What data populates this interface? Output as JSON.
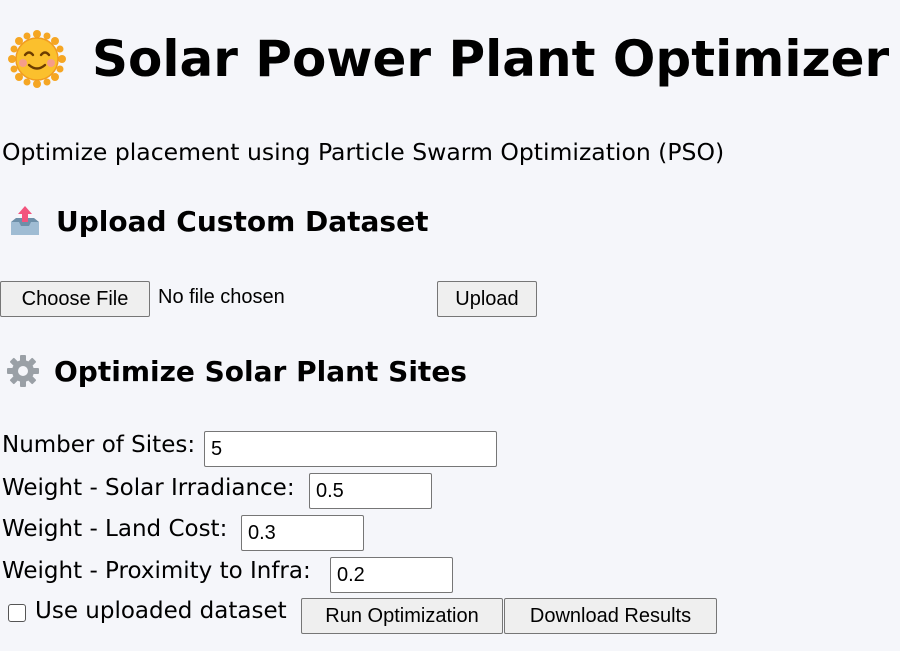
{
  "header": {
    "icon": "smiling-sun-icon",
    "title": "Solar Power Plant Optimizer",
    "subtitle": "Optimize placement using Particle Swarm Optimization (PSO)"
  },
  "upload_section": {
    "icon": "inbox-tray-upload-icon",
    "heading": "Upload Custom Dataset",
    "choose_file_label": "Choose File",
    "file_status": "No file chosen",
    "upload_label": "Upload"
  },
  "optimize_section": {
    "icon": "gear-icon",
    "heading": "Optimize Solar Plant Sites",
    "fields": [
      {
        "label": "Number of Sites:",
        "value": "5"
      },
      {
        "label": "Weight - Solar Irradiance:",
        "value": "0.5"
      },
      {
        "label": "Weight - Land Cost:",
        "value": "0.3"
      },
      {
        "label": "Weight - Proximity to Infra:",
        "value": "0.2"
      }
    ],
    "use_uploaded_label": "Use uploaded dataset",
    "use_uploaded_checked": false,
    "run_label": "Run Optimization",
    "download_label": "Download Results"
  },
  "colors": {
    "background": "#f5f6fa",
    "button_bg": "#efefef",
    "border": "#767676"
  }
}
